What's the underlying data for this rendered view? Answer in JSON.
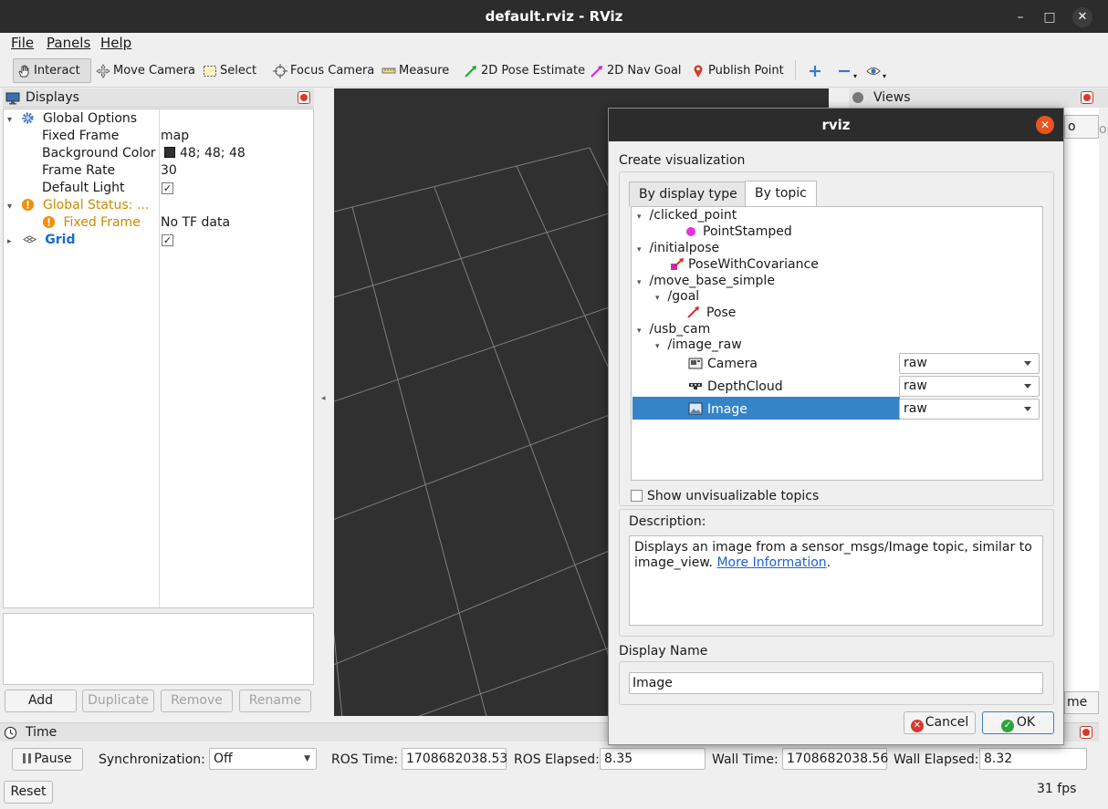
{
  "window": {
    "title": "default.rviz - RViz",
    "min": "–",
    "max": "□",
    "close": "✕"
  },
  "menu": {
    "file": "File",
    "panels": "Panels",
    "help": "Help"
  },
  "toolbar": {
    "interact": "Interact",
    "move_camera": "Move Camera",
    "select": "Select",
    "focus_camera": "Focus Camera",
    "measure": "Measure",
    "pose_estimate": "2D Pose Estimate",
    "nav_goal": "2D Nav Goal",
    "publish_point": "Publish Point"
  },
  "displays": {
    "title": "Displays",
    "global_options": "Global Options",
    "fixed_frame_label": "Fixed Frame",
    "fixed_frame_value": "map",
    "bg_color_label": "Background Color",
    "bg_color_value": "48; 48; 48",
    "frame_rate_label": "Frame Rate",
    "frame_rate_value": "30",
    "default_light_label": "Default Light",
    "global_status": "Global Status: ...",
    "status_fixed_frame": "Fixed Frame",
    "status_fixed_frame_value": "No TF data",
    "grid": "Grid",
    "buttons": {
      "add": "Add",
      "duplicate": "Duplicate",
      "remove": "Remove",
      "rename": "Rename"
    },
    "colors": {
      "warning": "#c98a00",
      "grid_blue": "#1a6ac9",
      "bg_swatch": "#303030"
    }
  },
  "views": {
    "title": "Views",
    "partial_button": "o",
    "partial_text": "os",
    "partial_button2": "me"
  },
  "time": {
    "title": "Time",
    "pause": "Pause",
    "sync_label": "Synchronization:",
    "sync_value": "Off",
    "ros_time_label": "ROS Time:",
    "ros_time": "1708682038.53",
    "ros_elapsed_label": "ROS Elapsed:",
    "ros_elapsed": "8.35",
    "wall_time_label": "Wall Time:",
    "wall_time": "1708682038.56",
    "wall_elapsed_label": "Wall Elapsed:",
    "wall_elapsed": "8.32",
    "reset": "Reset",
    "fps": "31 fps"
  },
  "dialog": {
    "title": "rviz",
    "heading": "Create visualization",
    "tabs": {
      "by_display_type": "By display type",
      "by_topic": "By topic"
    },
    "topics": {
      "clicked_point": "/clicked_point",
      "point_stamped": "PointStamped",
      "initialpose": "/initialpose",
      "pose_cov": "PoseWithCovariance",
      "move_base_simple": "/move_base_simple",
      "goal": "/goal",
      "pose": "Pose",
      "usb_cam": "/usb_cam",
      "image_raw": "/image_raw",
      "camera": "Camera",
      "depthcloud": "DepthCloud",
      "image": "Image",
      "camera_transport": "raw",
      "depth_transport": "raw",
      "image_transport": "raw"
    },
    "show_unvisualizable": "Show unvisualizable topics",
    "description_label": "Description:",
    "description_text": "Displays an image from a sensor_msgs/Image topic, similar to image_view.",
    "more_info": "More Information",
    "period": ".",
    "display_name_label": "Display Name",
    "display_name_value": "Image",
    "cancel": "Cancel",
    "ok": "OK",
    "colors": {
      "selection": "#3584c8",
      "close_button": "#e95420"
    }
  }
}
